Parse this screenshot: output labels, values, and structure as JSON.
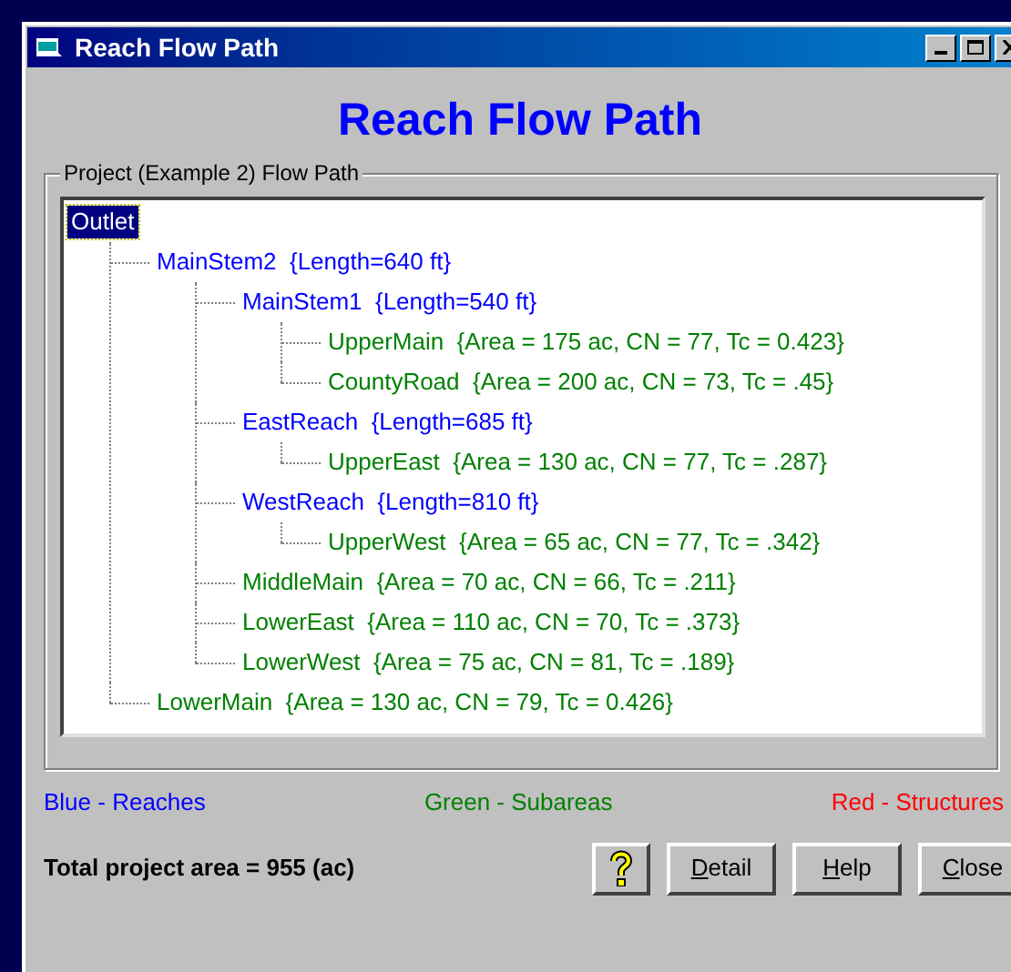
{
  "window": {
    "title": "Reach Flow Path"
  },
  "heading": "Reach Flow Path",
  "group": {
    "label": "Project (Example 2) Flow Path"
  },
  "tree": [
    {
      "label": "Outlet",
      "selected": true,
      "children": [
        {
          "label": "MainStem2  {Length=640 ft}",
          "color": "#0000ff",
          "selected": false,
          "children": [
            {
              "label": "MainStem1  {Length=540 ft}",
              "color": "#0000ff",
              "selected": false,
              "children": [
                {
                  "label": "UpperMain  {Area = 175 ac, CN = 77, Tc = 0.423}",
                  "color": "#008000",
                  "selected": false
                },
                {
                  "label": "CountyRoad  {Area = 200 ac, CN = 73, Tc = .45}",
                  "color": "#008000",
                  "selected": false
                }
              ]
            },
            {
              "label": "EastReach  {Length=685 ft}",
              "color": "#0000ff",
              "selected": false,
              "children": [
                {
                  "label": "UpperEast  {Area = 130 ac, CN = 77, Tc = .287}",
                  "color": "#008000",
                  "selected": false
                }
              ]
            },
            {
              "label": "WestReach  {Length=810 ft}",
              "color": "#0000ff",
              "selected": false,
              "children": [
                {
                  "label": "UpperWest  {Area = 65 ac, CN = 77, Tc = .342}",
                  "color": "#008000",
                  "selected": false
                }
              ]
            },
            {
              "label": "MiddleMain  {Area = 70 ac, CN = 66, Tc = .211}",
              "color": "#008000",
              "selected": false
            },
            {
              "label": "LowerEast  {Area = 110 ac, CN = 70, Tc = .373}",
              "color": "#008000",
              "selected": false
            },
            {
              "label": "LowerWest  {Area = 75 ac, CN = 81, Tc = .189}",
              "color": "#008000",
              "selected": false
            }
          ]
        },
        {
          "label": "LowerMain  {Area = 130 ac, CN = 79, Tc = 0.426}",
          "color": "#008000",
          "selected": false
        }
      ]
    }
  ],
  "legend": [
    {
      "label": "Blue - Reaches",
      "color": "#0000ff"
    },
    {
      "label": "Green - Subareas",
      "color": "#008000"
    },
    {
      "label": "Red - Structures",
      "color": "#ff0000"
    }
  ],
  "total": "Total project area = 955 (ac)",
  "buttons": [
    {
      "label": "Detail"
    },
    {
      "label": "Help"
    },
    {
      "label": "Close"
    }
  ]
}
